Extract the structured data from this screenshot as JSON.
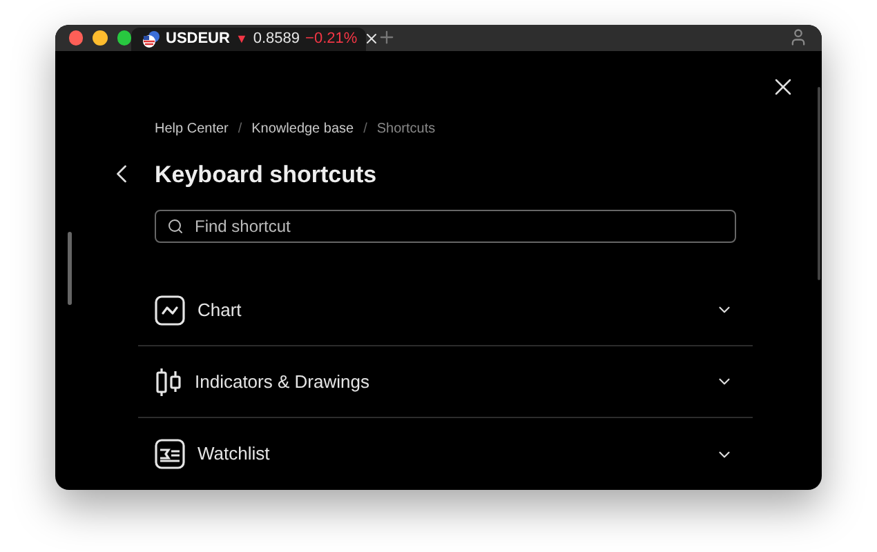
{
  "tab": {
    "symbol": "USDEUR",
    "falling": true,
    "arrow": "▼",
    "price": "0.8589",
    "change": "−0.21%"
  },
  "breadcrumbs": [
    {
      "label": "Help Center",
      "current": false
    },
    {
      "label": "Knowledge base",
      "current": false
    },
    {
      "label": "Shortcuts",
      "current": true
    }
  ],
  "breadcrumb_separators": [
    "/",
    "/"
  ],
  "title": "Keyboard shortcuts",
  "search": {
    "placeholder": "Find shortcut"
  },
  "sections": [
    {
      "kind": "chart",
      "label": "Chart",
      "expanded": false
    },
    {
      "kind": "indicators",
      "label": "Indicators & Drawings",
      "expanded": false
    },
    {
      "kind": "watchlist",
      "label": "Watchlist",
      "expanded": false
    }
  ]
}
